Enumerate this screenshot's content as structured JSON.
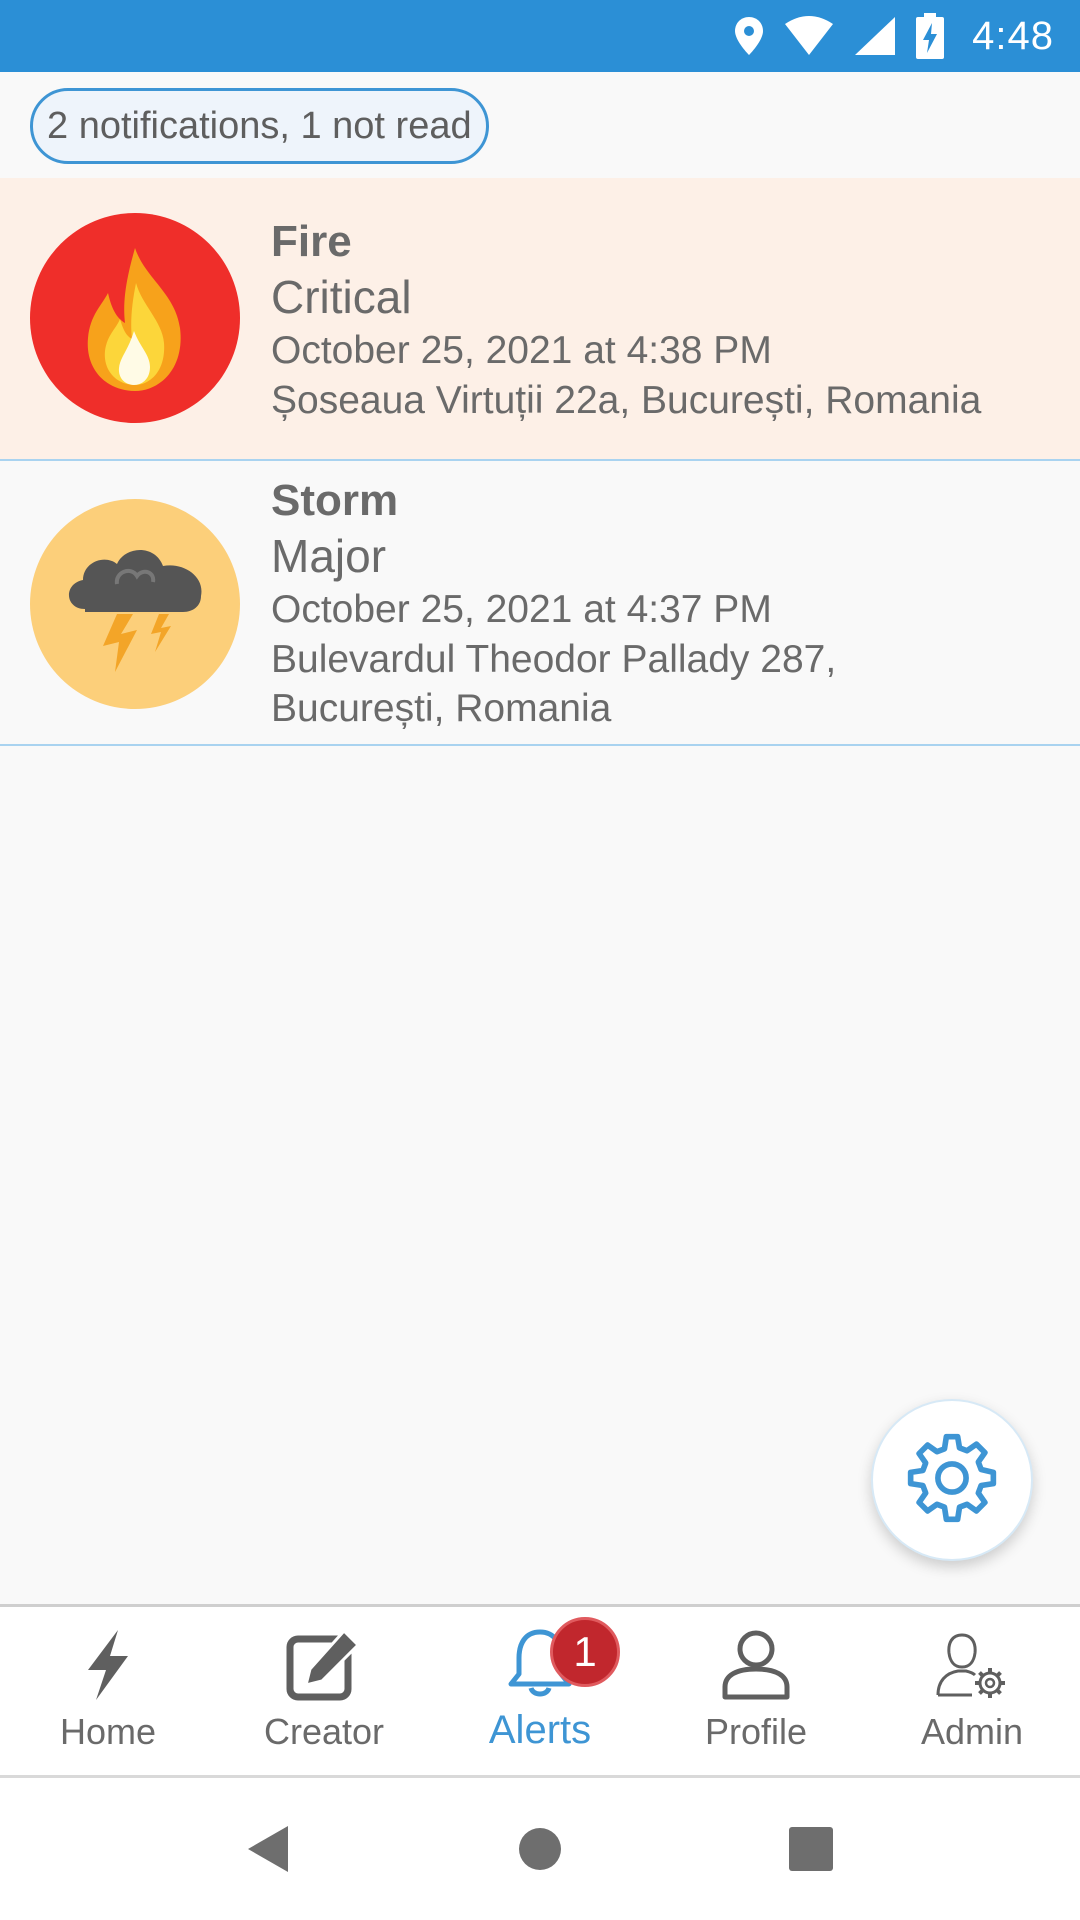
{
  "status_bar": {
    "time": "4:48",
    "icons": [
      "location-icon",
      "wifi-icon",
      "signal-icon",
      "battery-charging-icon"
    ],
    "color": "#2b8fd6"
  },
  "summary": {
    "text": "2 notifications, 1 not read"
  },
  "notifications": [
    {
      "title": "Fire",
      "severity": "Critical",
      "date": "October 25, 2021 at 4:38 PM",
      "address": "Șoseaua Virtuții 22a, București, Romania",
      "icon": "fire-icon",
      "read": false
    },
    {
      "title": "Storm",
      "severity": "Major",
      "date": "October 25, 2021 at 4:37 PM",
      "address": "Bulevardul Theodor Pallady 287, București, Romania",
      "icon": "storm-icon",
      "read": true
    }
  ],
  "fab": {
    "icon": "gear-icon"
  },
  "tabs": [
    {
      "label": "Home",
      "icon": "lightning-icon",
      "active": false
    },
    {
      "label": "Creator",
      "icon": "edit-icon",
      "active": false
    },
    {
      "label": "Alerts",
      "icon": "bell-icon",
      "active": true,
      "badge": "1"
    },
    {
      "label": "Profile",
      "icon": "user-icon",
      "active": false
    },
    {
      "label": "Admin",
      "icon": "admin-gear-user-icon",
      "active": false
    }
  ],
  "nav_bar": {
    "buttons": [
      "back-icon",
      "home-circle-icon",
      "recents-square-icon"
    ]
  },
  "colors": {
    "accent": "#3e95d4",
    "unread_background": "#fdf0e7",
    "badge": "#c1272d",
    "fire_circle": "#ef2e2a",
    "storm_circle": "#fccf7a"
  }
}
